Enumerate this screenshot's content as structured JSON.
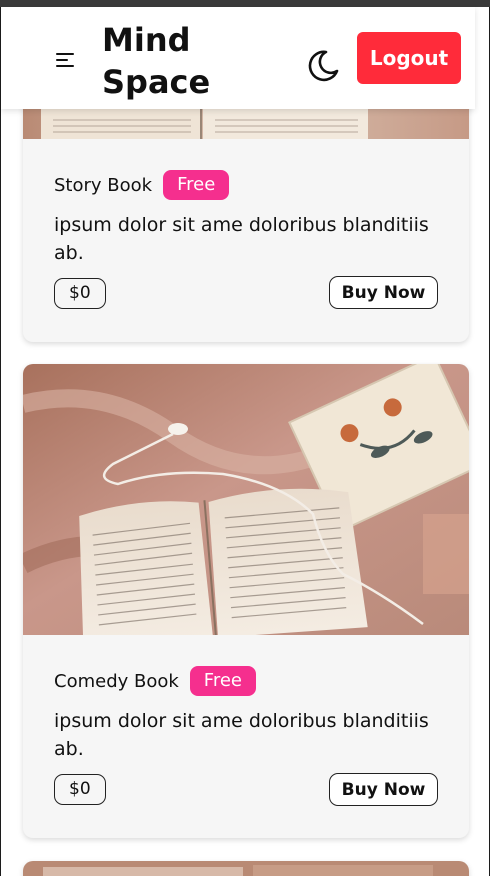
{
  "navbar": {
    "brand_line1": "Mind",
    "brand_line2": "Space",
    "logout_label": "Logout",
    "menu_icon": "hamburger-icon",
    "theme_icon": "moon-icon"
  },
  "colors": {
    "accent_red": "#ff2b3a",
    "badge_pink": "#f52f8e",
    "card_bg": "#f6f6f6"
  },
  "cards": [
    {
      "title": "Story Book",
      "badge": "Free",
      "description": "ipsum dolor sit ame doloribus blanditiis ab.",
      "price": "$0",
      "button": "Buy Now"
    },
    {
      "title": "Comedy Book",
      "badge": "Free",
      "description": "ipsum dolor sit ame doloribus blanditiis ab.",
      "price": "$0",
      "button": "Buy Now"
    }
  ]
}
